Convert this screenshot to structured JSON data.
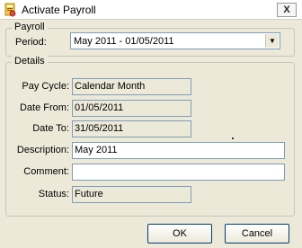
{
  "window": {
    "title": "Activate Payroll",
    "close_glyph": "X"
  },
  "payroll_group": {
    "legend": "Payroll",
    "period_label": "Period:",
    "period_value": "May 2011 - 01/05/2011"
  },
  "details_group": {
    "legend": "Details",
    "pay_cycle_label": "Pay Cycle:",
    "pay_cycle_value": "Calendar Month",
    "date_from_label": "Date From:",
    "date_from_value": "01/05/2011",
    "date_to_label": "Date To:",
    "date_to_value": "31/05/2011",
    "description_label": "Description:",
    "description_value": "May 2011",
    "comment_label": "Comment:",
    "comment_value": "",
    "status_label": "Status:",
    "status_value": "Future"
  },
  "buttons": {
    "ok_label": "OK",
    "cancel_label": "Cancel"
  },
  "icons": {
    "app": "payroll-app-icon",
    "dropdown": "chevron-down-icon",
    "close": "close-icon"
  }
}
